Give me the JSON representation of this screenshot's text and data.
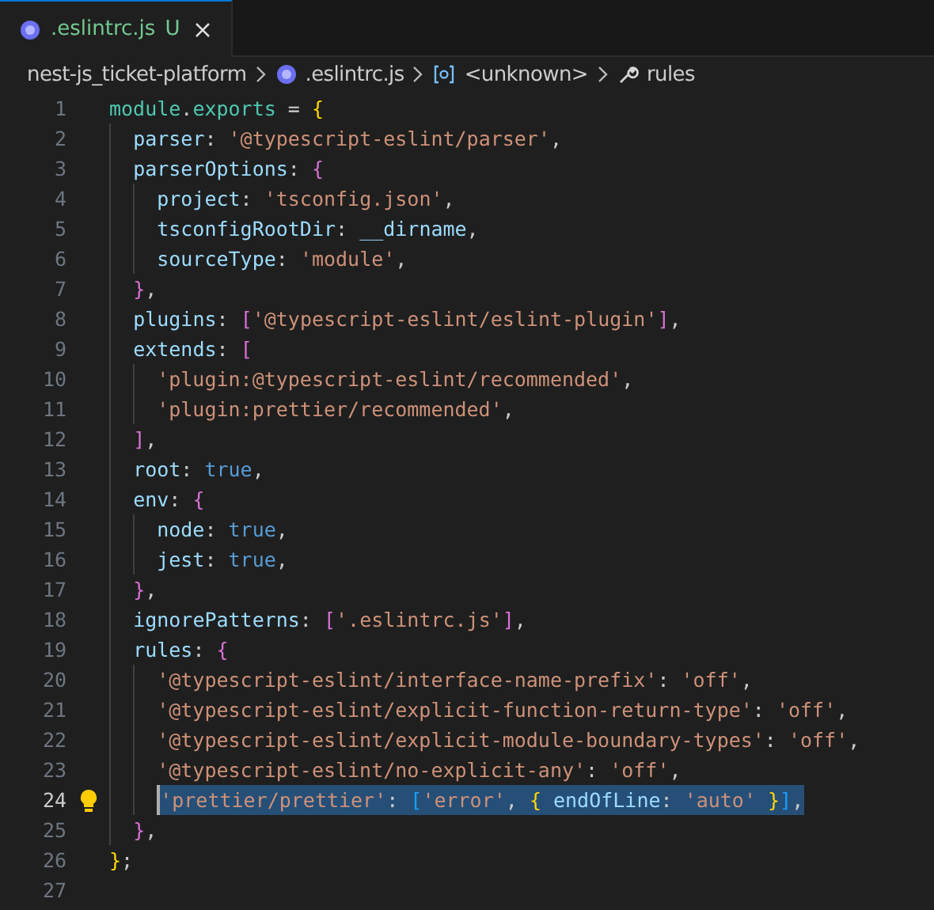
{
  "tabs": [
    {
      "label": ".eslintrc.js",
      "status": "U",
      "selected": true
    }
  ],
  "breadcrumb": [
    {
      "kind": "folder",
      "label": "nest-js_ticket-platform"
    },
    {
      "kind": "file",
      "label": ".eslintrc.js"
    },
    {
      "kind": "symbol",
      "label": "<unknown>"
    },
    {
      "kind": "property",
      "label": "rules"
    }
  ],
  "lines": [
    {
      "number": "1",
      "active": false,
      "selected": false,
      "hint": false,
      "tokens": [
        {
          "kind": "obj",
          "text": "module"
        },
        {
          "kind": "p",
          "text": "."
        },
        {
          "kind": "obj",
          "text": "exports"
        },
        {
          "kind": "p",
          "text": " = "
        },
        {
          "kind": "b1",
          "text": "{"
        }
      ]
    },
    {
      "number": "2",
      "active": false,
      "selected": false,
      "hint": false,
      "tokens": [
        {
          "kind": "var",
          "text": "  parser"
        },
        {
          "kind": "p",
          "text": ": "
        },
        {
          "kind": "str",
          "text": "'@typescript-eslint/parser'"
        },
        {
          "kind": "p",
          "text": ","
        }
      ]
    },
    {
      "number": "3",
      "active": false,
      "selected": false,
      "hint": false,
      "tokens": [
        {
          "kind": "var",
          "text": "  parserOptions"
        },
        {
          "kind": "p",
          "text": ": "
        },
        {
          "kind": "b2",
          "text": "{"
        }
      ]
    },
    {
      "number": "4",
      "active": false,
      "selected": false,
      "hint": false,
      "tokens": [
        {
          "kind": "var",
          "text": "    project"
        },
        {
          "kind": "p",
          "text": ": "
        },
        {
          "kind": "str",
          "text": "'tsconfig.json'"
        },
        {
          "kind": "p",
          "text": ","
        }
      ]
    },
    {
      "number": "5",
      "active": false,
      "selected": false,
      "hint": false,
      "tokens": [
        {
          "kind": "var",
          "text": "    tsconfigRootDir"
        },
        {
          "kind": "p",
          "text": ": "
        },
        {
          "kind": "var",
          "text": "__dirname"
        },
        {
          "kind": "p",
          "text": ","
        }
      ]
    },
    {
      "number": "6",
      "active": false,
      "selected": false,
      "hint": false,
      "tokens": [
        {
          "kind": "var",
          "text": "    sourceType"
        },
        {
          "kind": "p",
          "text": ": "
        },
        {
          "kind": "str",
          "text": "'module'"
        },
        {
          "kind": "p",
          "text": ","
        }
      ]
    },
    {
      "number": "7",
      "active": false,
      "selected": false,
      "hint": false,
      "tokens": [
        {
          "kind": "b2",
          "text": "  }"
        },
        {
          "kind": "p",
          "text": ","
        }
      ]
    },
    {
      "number": "8",
      "active": false,
      "selected": false,
      "hint": false,
      "tokens": [
        {
          "kind": "var",
          "text": "  plugins"
        },
        {
          "kind": "p",
          "text": ": "
        },
        {
          "kind": "b2",
          "text": "["
        },
        {
          "kind": "str",
          "text": "'@typescript-eslint/eslint-plugin'"
        },
        {
          "kind": "b2",
          "text": "]"
        },
        {
          "kind": "p",
          "text": ","
        }
      ]
    },
    {
      "number": "9",
      "active": false,
      "selected": false,
      "hint": false,
      "tokens": [
        {
          "kind": "var",
          "text": "  extends"
        },
        {
          "kind": "p",
          "text": ": "
        },
        {
          "kind": "b2",
          "text": "["
        }
      ]
    },
    {
      "number": "10",
      "active": false,
      "selected": false,
      "hint": false,
      "tokens": [
        {
          "kind": "str",
          "text": "    'plugin:@typescript-eslint/recommended'"
        },
        {
          "kind": "p",
          "text": ","
        }
      ]
    },
    {
      "number": "11",
      "active": false,
      "selected": false,
      "hint": false,
      "tokens": [
        {
          "kind": "str",
          "text": "    'plugin:prettier/recommended'"
        },
        {
          "kind": "p",
          "text": ","
        }
      ]
    },
    {
      "number": "12",
      "active": false,
      "selected": false,
      "hint": false,
      "tokens": [
        {
          "kind": "b2",
          "text": "  ]"
        },
        {
          "kind": "p",
          "text": ","
        }
      ]
    },
    {
      "number": "13",
      "active": false,
      "selected": false,
      "hint": false,
      "tokens": [
        {
          "kind": "var",
          "text": "  root"
        },
        {
          "kind": "p",
          "text": ": "
        },
        {
          "kind": "kw",
          "text": "true"
        },
        {
          "kind": "p",
          "text": ","
        }
      ]
    },
    {
      "number": "14",
      "active": false,
      "selected": false,
      "hint": false,
      "tokens": [
        {
          "kind": "var",
          "text": "  env"
        },
        {
          "kind": "p",
          "text": ": "
        },
        {
          "kind": "b2",
          "text": "{"
        }
      ]
    },
    {
      "number": "15",
      "active": false,
      "selected": false,
      "hint": false,
      "tokens": [
        {
          "kind": "var",
          "text": "    node"
        },
        {
          "kind": "p",
          "text": ": "
        },
        {
          "kind": "kw",
          "text": "true"
        },
        {
          "kind": "p",
          "text": ","
        }
      ]
    },
    {
      "number": "16",
      "active": false,
      "selected": false,
      "hint": false,
      "tokens": [
        {
          "kind": "var",
          "text": "    jest"
        },
        {
          "kind": "p",
          "text": ": "
        },
        {
          "kind": "kw",
          "text": "true"
        },
        {
          "kind": "p",
          "text": ","
        }
      ]
    },
    {
      "number": "17",
      "active": false,
      "selected": false,
      "hint": false,
      "tokens": [
        {
          "kind": "b2",
          "text": "  }"
        },
        {
          "kind": "p",
          "text": ","
        }
      ]
    },
    {
      "number": "18",
      "active": false,
      "selected": false,
      "hint": false,
      "tokens": [
        {
          "kind": "var",
          "text": "  ignorePatterns"
        },
        {
          "kind": "p",
          "text": ": "
        },
        {
          "kind": "b2",
          "text": "["
        },
        {
          "kind": "str",
          "text": "'.eslintrc.js'"
        },
        {
          "kind": "b2",
          "text": "]"
        },
        {
          "kind": "p",
          "text": ","
        }
      ]
    },
    {
      "number": "19",
      "active": false,
      "selected": false,
      "hint": false,
      "tokens": [
        {
          "kind": "var",
          "text": "  rules"
        },
        {
          "kind": "p",
          "text": ": "
        },
        {
          "kind": "b2",
          "text": "{"
        }
      ]
    },
    {
      "number": "20",
      "active": false,
      "selected": false,
      "hint": false,
      "tokens": [
        {
          "kind": "str",
          "text": "    '@typescript-eslint/interface-name-prefix'"
        },
        {
          "kind": "p",
          "text": ": "
        },
        {
          "kind": "str",
          "text": "'off'"
        },
        {
          "kind": "p",
          "text": ","
        }
      ]
    },
    {
      "number": "21",
      "active": false,
      "selected": false,
      "hint": false,
      "tokens": [
        {
          "kind": "str",
          "text": "    '@typescript-eslint/explicit-function-return-type'"
        },
        {
          "kind": "p",
          "text": ": "
        },
        {
          "kind": "str",
          "text": "'off'"
        },
        {
          "kind": "p",
          "text": ","
        }
      ]
    },
    {
      "number": "22",
      "active": false,
      "selected": false,
      "hint": false,
      "tokens": [
        {
          "kind": "str",
          "text": "    '@typescript-eslint/explicit-module-boundary-types'"
        },
        {
          "kind": "p",
          "text": ": "
        },
        {
          "kind": "str",
          "text": "'off'"
        },
        {
          "kind": "p",
          "text": ","
        }
      ]
    },
    {
      "number": "23",
      "active": false,
      "selected": false,
      "hint": false,
      "tokens": [
        {
          "kind": "str",
          "text": "    '@typescript-eslint/no-explicit-any'"
        },
        {
          "kind": "p",
          "text": ": "
        },
        {
          "kind": "str",
          "text": "'off'"
        },
        {
          "kind": "p",
          "text": ","
        }
      ]
    },
    {
      "number": "24",
      "active": true,
      "selected": true,
      "hint": true,
      "tokens": [
        {
          "kind": "str",
          "text": "    'prettier/prettier'"
        },
        {
          "kind": "p",
          "text": ": "
        },
        {
          "kind": "b3",
          "text": "["
        },
        {
          "kind": "str",
          "text": "'error'"
        },
        {
          "kind": "p",
          "text": ", "
        },
        {
          "kind": "b1",
          "text": "{"
        },
        {
          "kind": "var",
          "text": " endOfLine"
        },
        {
          "kind": "p",
          "text": ": "
        },
        {
          "kind": "str",
          "text": "'auto'"
        },
        {
          "kind": "b1",
          "text": " }"
        },
        {
          "kind": "b3",
          "text": "]"
        },
        {
          "kind": "p",
          "text": ","
        }
      ]
    },
    {
      "number": "25",
      "active": false,
      "selected": false,
      "hint": false,
      "tokens": [
        {
          "kind": "b2",
          "text": "  }"
        },
        {
          "kind": "p",
          "text": ","
        }
      ]
    },
    {
      "number": "26",
      "active": false,
      "selected": false,
      "hint": false,
      "tokens": [
        {
          "kind": "b1",
          "text": "}"
        },
        {
          "kind": "p",
          "text": ";"
        }
      ]
    },
    {
      "number": "27",
      "active": false,
      "selected": false,
      "hint": false
    }
  ]
}
